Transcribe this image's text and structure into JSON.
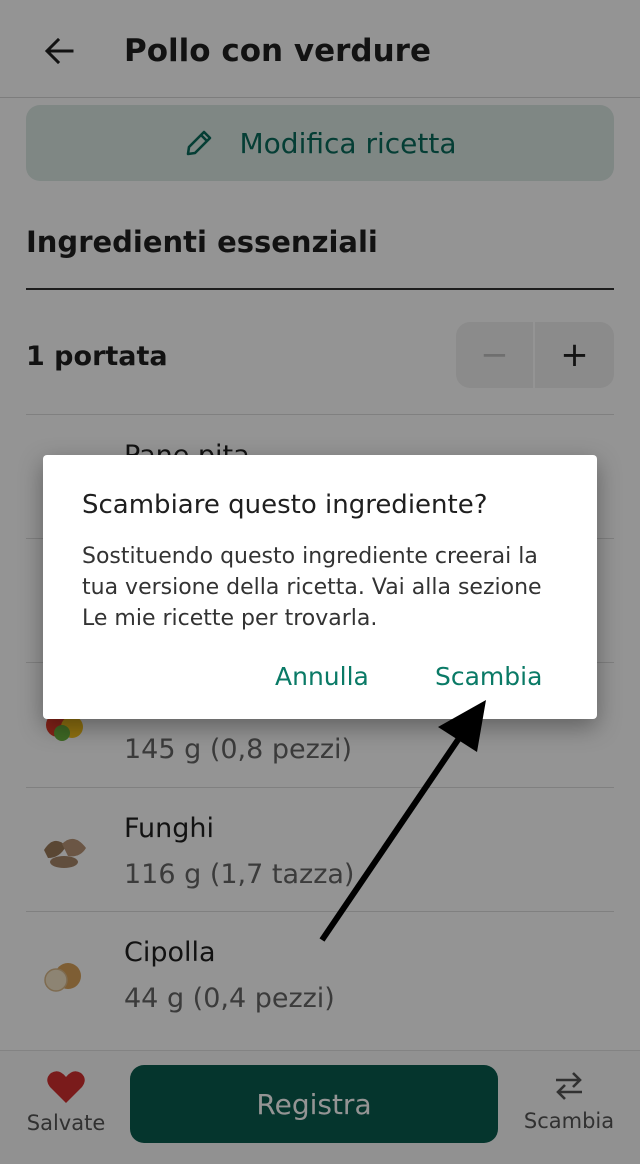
{
  "header": {
    "back_icon": "arrow-left-icon",
    "title": "Pollo con verdure"
  },
  "edit_button": {
    "icon": "pencil-icon",
    "label": "Modifica ricetta"
  },
  "ingredients": {
    "section_title": "Ingredienti essenziali",
    "servings_label": "1 portata",
    "stepper": {
      "minus": "−",
      "plus": "+"
    },
    "items": [
      {
        "name": "Pane pita",
        "qty": "",
        "icon": "pita-bread-icon"
      },
      {
        "name": "",
        "qty": "",
        "icon": "ingredient-icon"
      },
      {
        "name": "",
        "qty": "145 g (0,8 pezzi)",
        "icon": "bell-pepper-icon"
      },
      {
        "name": "Funghi",
        "qty": "116 g (1,7 tazza)",
        "icon": "mushroom-icon"
      },
      {
        "name": "Cipolla",
        "qty": "44 g (0,4 pezzi)",
        "icon": "onion-icon"
      }
    ]
  },
  "bottom_nav": {
    "saved_label": "Salvate",
    "saved_icon": "heart-icon",
    "register_label": "Registra",
    "swap_label": "Scambia",
    "swap_icon": "swap-arrows-icon"
  },
  "dialog": {
    "title": "Scambiare questo ingrediente?",
    "body": "Sostituendo questo ingrediente creerai la tua versione della ricetta. Vai alla sezione Le mie ricette per trovarla.",
    "cancel": "Annulla",
    "confirm": "Scambia"
  },
  "colors": {
    "accent": "#0a7a66",
    "primary_button": "#0a5c4f",
    "edit_button_bg": "#dbe8e4",
    "heart": "#d32f2f"
  }
}
